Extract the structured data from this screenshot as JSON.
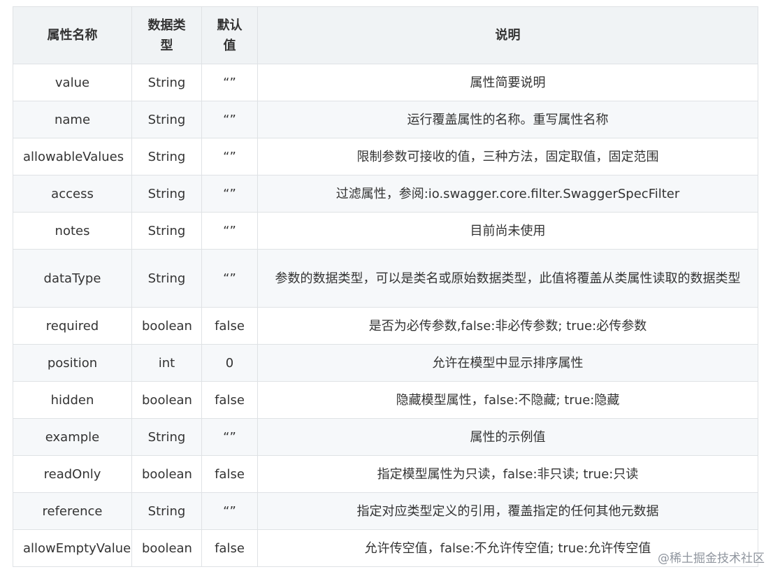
{
  "table": {
    "headers": {
      "name": "属性名称",
      "type": "数据类型",
      "default": "默认值",
      "desc": "说明"
    },
    "rows": [
      {
        "name": "value",
        "type": "String",
        "default": "“”",
        "desc": "属性简要说明"
      },
      {
        "name": "name",
        "type": "String",
        "default": "“”",
        "desc": "运行覆盖属性的名称。重写属性名称"
      },
      {
        "name": "allowableValues",
        "type": "String",
        "default": "“”",
        "desc": "限制参数可接收的值，三种方法，固定取值，固定范围"
      },
      {
        "name": "access",
        "type": "String",
        "default": "“”",
        "desc": "过滤属性，参阅:io.swagger.core.filter.SwaggerSpecFilter"
      },
      {
        "name": "notes",
        "type": "String",
        "default": "“”",
        "desc": "目前尚未使用"
      },
      {
        "name": "dataType",
        "type": "String",
        "default": "“”",
        "desc": "参数的数据类型，可以是类名或原始数据类型，此值将覆盖从类属性读取的数据类型"
      },
      {
        "name": "required",
        "type": "boolean",
        "default": "false",
        "desc": "是否为必传参数,false:非必传参数; true:必传参数"
      },
      {
        "name": "position",
        "type": "int",
        "default": "0",
        "desc": "允许在模型中显示排序属性"
      },
      {
        "name": "hidden",
        "type": "boolean",
        "default": "false",
        "desc": "隐藏模型属性，false:不隐藏; true:隐藏"
      },
      {
        "name": "example",
        "type": "String",
        "default": "“”",
        "desc": "属性的示例值"
      },
      {
        "name": "readOnly",
        "type": "boolean",
        "default": "false",
        "desc": "指定模型属性为只读，false:非只读; true:只读"
      },
      {
        "name": "reference",
        "type": "String",
        "default": "“”",
        "desc": "指定对应类型定义的引用，覆盖指定的任何其他元数据"
      },
      {
        "name": "allowEmptyValue",
        "type": "boolean",
        "default": "false",
        "desc": "允许传空值，false:不允许传空值; true:允许传空值"
      }
    ]
  },
  "watermark": "@稀土掘金技术社区"
}
